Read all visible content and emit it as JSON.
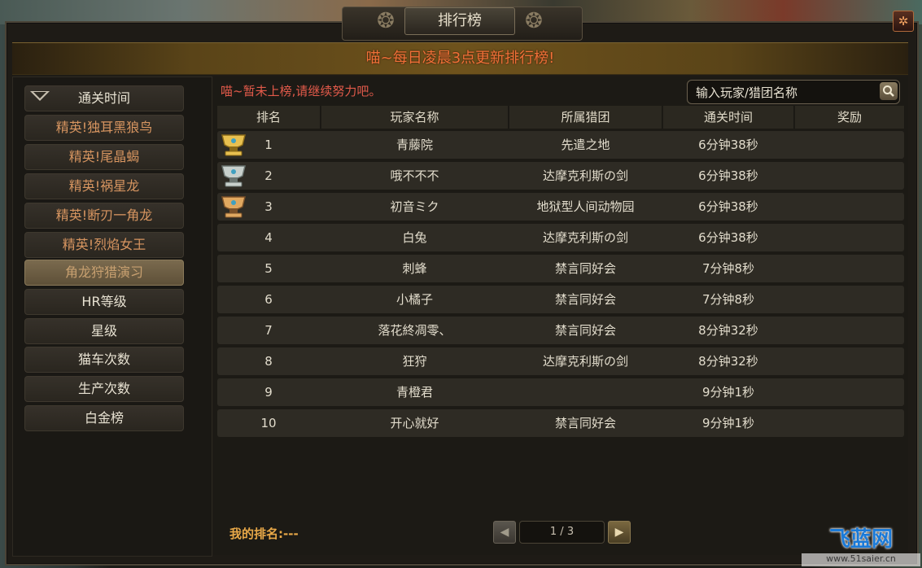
{
  "window": {
    "title": "排行榜",
    "close_icon": "close-icon",
    "banner": "喵~每日凌晨3点更新排行榜!"
  },
  "sidebar": {
    "items": [
      {
        "label": "通关时间",
        "type": "header"
      },
      {
        "label": "精英!独耳黑狼鸟",
        "type": "sub"
      },
      {
        "label": "精英!尾晶蝎",
        "type": "sub"
      },
      {
        "label": "精英!祸星龙",
        "type": "sub"
      },
      {
        "label": "精英!断刃一角龙",
        "type": "sub"
      },
      {
        "label": "精英!烈焰女王",
        "type": "sub"
      },
      {
        "label": "角龙狩猎演习",
        "type": "active"
      },
      {
        "label": "HR等级",
        "type": "normal"
      },
      {
        "label": "星级",
        "type": "normal"
      },
      {
        "label": "猫车次数",
        "type": "normal"
      },
      {
        "label": "生产次数",
        "type": "normal"
      },
      {
        "label": "白金榜",
        "type": "normal"
      }
    ]
  },
  "main": {
    "notice": "喵~暂未上榜,请继续努力吧。",
    "search": {
      "placeholder": "输入玩家/猎团名称",
      "icon": "search-icon"
    },
    "columns": [
      "排名",
      "玩家名称",
      "所属猎团",
      "通关时间",
      "奖励"
    ],
    "rows": [
      {
        "rank": "1",
        "player": "青藤院",
        "guild": "先遣之地",
        "time": "6分钟38秒",
        "trophy": "gold"
      },
      {
        "rank": "2",
        "player": "哦不不不",
        "guild": "达摩克利斯の剑",
        "time": "6分钟38秒",
        "trophy": "silver"
      },
      {
        "rank": "3",
        "player": "初音ミク",
        "guild": "地狱型人间动物园",
        "time": "6分钟38秒",
        "trophy": "bronze"
      },
      {
        "rank": "4",
        "player": "白兔",
        "guild": "达摩克利斯の剑",
        "time": "6分钟38秒",
        "trophy": ""
      },
      {
        "rank": "5",
        "player": "刺蜂",
        "guild": "禁言同好会",
        "time": "7分钟8秒",
        "trophy": ""
      },
      {
        "rank": "6",
        "player": "小橘子",
        "guild": "禁言同好会",
        "time": "7分钟8秒",
        "trophy": ""
      },
      {
        "rank": "7",
        "player": "落花終凋零、",
        "guild": "禁言同好会",
        "time": "8分钟32秒",
        "trophy": ""
      },
      {
        "rank": "8",
        "player": "狂狩",
        "guild": "达摩克利斯の剑",
        "time": "8分钟32秒",
        "trophy": ""
      },
      {
        "rank": "9",
        "player": "青橙君",
        "guild": "",
        "time": "9分钟1秒",
        "trophy": ""
      },
      {
        "rank": "10",
        "player": "开心就好",
        "guild": "禁言同好会",
        "time": "9分钟1秒",
        "trophy": ""
      }
    ],
    "my_rank": "我的排名:---",
    "pager": {
      "text": "1 / 3",
      "prev_icon": "chevron-left-icon",
      "next_icon": "chevron-right-icon"
    }
  },
  "watermark": {
    "logo": "飞蓝网",
    "url": "www.51saier.cn"
  },
  "colors": {
    "banner_text": "#f07038",
    "notice": "#e25a4a",
    "my_rank": "#e8a848",
    "sub_item": "#d79560"
  }
}
